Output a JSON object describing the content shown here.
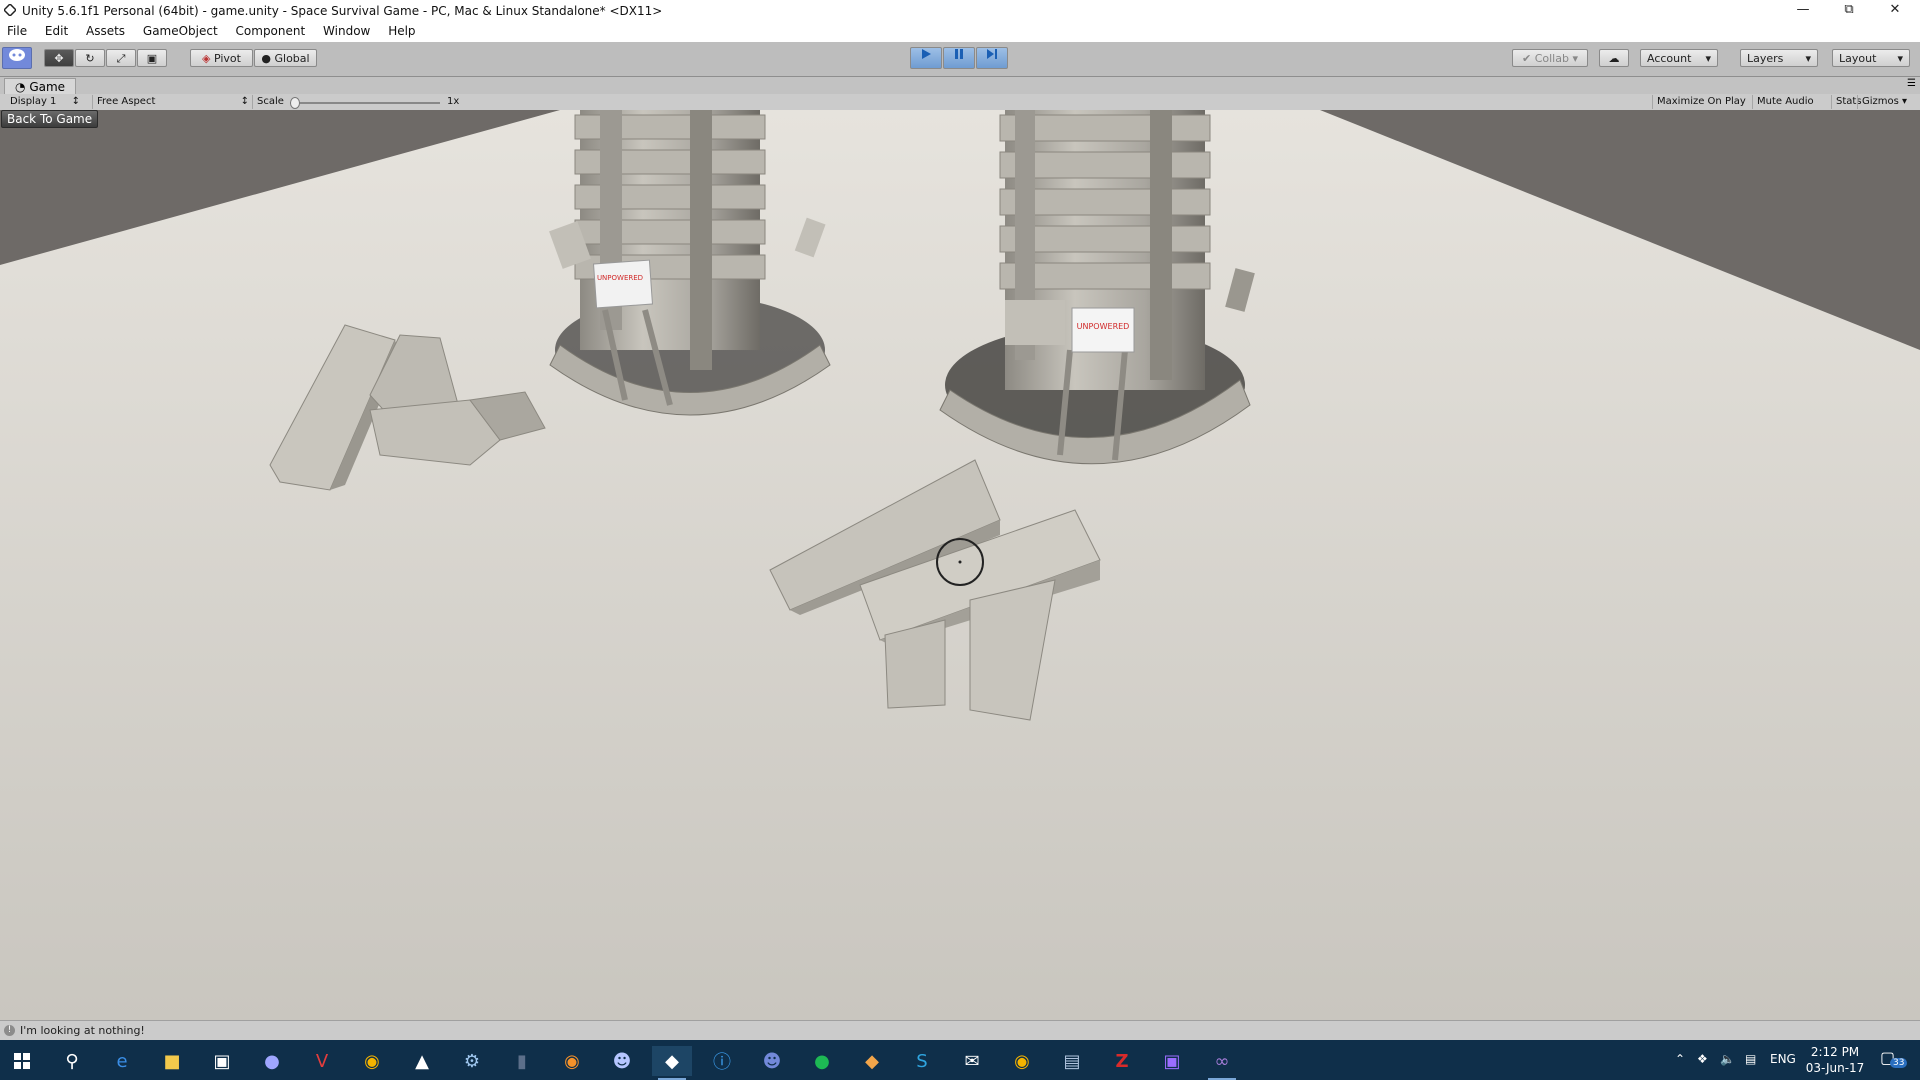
{
  "window": {
    "title": "Unity 5.6.1f1 Personal (64bit) - game.unity - Space Survival Game - PC, Mac & Linux Standalone* <DX11>"
  },
  "menu": [
    "File",
    "Edit",
    "Assets",
    "GameObject",
    "Component",
    "Window",
    "Help"
  ],
  "toolbar": {
    "pivot_label": "Pivot",
    "global_label": "Global",
    "collab_label": "Collab",
    "account_label": "Account",
    "layers_label": "Layers",
    "layout_label": "Layout"
  },
  "game_view": {
    "tab_label": "Game",
    "display": "Display 1",
    "aspect": "Free Aspect",
    "scale_label": "Scale",
    "scale_value": "1x",
    "maximize_label": "Maximize On Play",
    "mute_label": "Mute Audio",
    "stats_label": "Stats",
    "gizmos_label": "Gizmos",
    "back_button": "Back To Game",
    "sign_text": "UNPOWERED"
  },
  "status": {
    "message": "I'm looking at nothing!"
  },
  "taskbar": {
    "language": "ENG",
    "time": "2:12 PM",
    "date": "03-Jun-17",
    "notification_count": "33"
  },
  "colors": {
    "floor": "#d2d0ca",
    "background": "#6f6a66",
    "taskbar": "#0f2f4a",
    "sign_text": "#d12b2b"
  }
}
